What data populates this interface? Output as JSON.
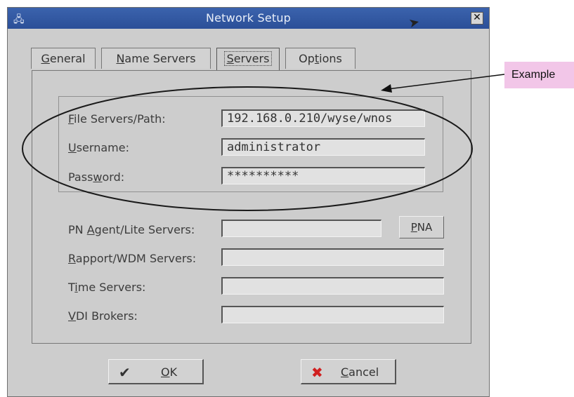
{
  "window": {
    "title": "Network Setup"
  },
  "tabs": [
    {
      "pre": "",
      "u": "G",
      "post": "eneral"
    },
    {
      "pre": "",
      "u": "N",
      "post": "ame Servers"
    },
    {
      "pre": "",
      "u": "S",
      "post": "ervers"
    },
    {
      "pre": "Op",
      "u": "t",
      "post": "ions"
    }
  ],
  "servers_group": {
    "file_servers": {
      "u": "F",
      "rest": "ile Servers/Path:",
      "value": "192.168.0.210/wyse/wnos"
    },
    "username": {
      "u": "U",
      "rest": "sername:",
      "value": "administrator"
    },
    "password": {
      "pre": "Pass",
      "u": "w",
      "rest": "ord:",
      "value": "**********"
    }
  },
  "fields": {
    "pn_agent": {
      "pre": "PN ",
      "u": "A",
      "rest": "gent/Lite Servers:",
      "value": "",
      "button": {
        "u": "P",
        "rest": "NA"
      }
    },
    "rapport": {
      "u": "R",
      "rest": "apport/WDM Servers:",
      "value": ""
    },
    "time": {
      "pre": "T",
      "u": "i",
      "rest": "me Servers:",
      "value": ""
    },
    "vdi": {
      "u": "V",
      "rest": "DI Brokers:",
      "value": ""
    }
  },
  "buttons": {
    "ok": {
      "u": "O",
      "rest": "K"
    },
    "cancel": {
      "u": "C",
      "rest": "ancel"
    }
  },
  "annotation": {
    "text": "Example"
  }
}
